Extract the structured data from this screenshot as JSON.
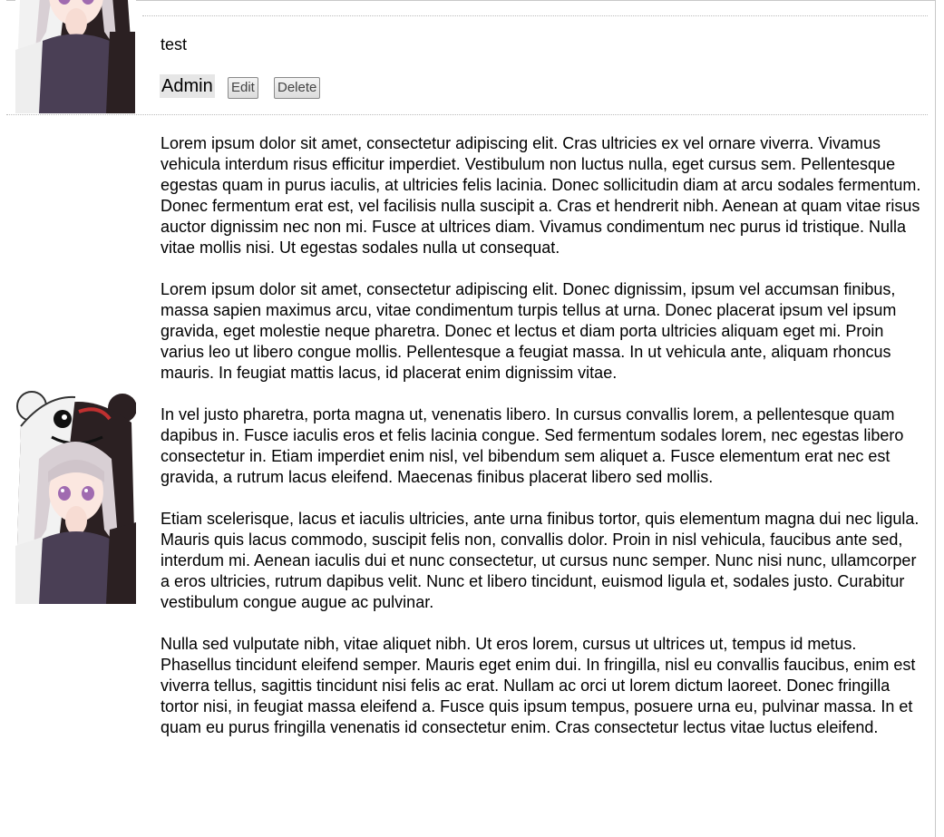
{
  "post": {
    "title": "test",
    "author": "Admin",
    "edit_label": "Edit",
    "delete_label": "Delete",
    "paragraphs": [
      "Lorem ipsum dolor sit amet, consectetur adipiscing elit. Cras ultricies ex vel ornare viverra. Vivamus vehicula interdum risus efficitur imperdiet. Vestibulum non luctus nulla, eget cursus sem. Pellentesque egestas quam in purus iaculis, at ultricies felis lacinia. Donec sollicitudin diam at arcu sodales fermentum. Donec fermentum erat est, vel facilisis nulla suscipit a. Cras et hendrerit nibh. Aenean at quam vitae risus auctor dignissim nec non mi. Fusce at ultrices diam. Vivamus condimentum nec purus id tristique. Nulla vitae mollis nisi. Ut egestas sodales nulla ut consequat.",
      "Lorem ipsum dolor sit amet, consectetur adipiscing elit. Donec dignissim, ipsum vel accumsan finibus, massa sapien maximus arcu, vitae condimentum turpis tellus at urna. Donec placerat ipsum vel ipsum gravida, eget molestie neque pharetra. Donec et lectus et diam porta ultricies aliquam eget mi. Proin varius leo ut libero congue mollis. Pellentesque a feugiat massa. In ut vehicula ante, aliquam rhoncus mauris. In feugiat mattis lacus, id placerat enim dignissim vitae.",
      "In vel justo pharetra, porta magna ut, venenatis libero. In cursus convallis lorem, a pellentesque quam dapibus in. Fusce iaculis eros et felis lacinia congue. Sed fermentum sodales lorem, nec egestas libero consectetur in. Etiam imperdiet enim nisl, vel bibendum sem aliquet a. Fusce elementum erat nec est gravida, a rutrum lacus eleifend. Maecenas finibus placerat libero sed mollis.",
      "Etiam scelerisque, lacus et iaculis ultricies, ante urna finibus tortor, quis elementum magna dui nec ligula. Mauris quis lacus commodo, suscipit felis non, convallis dolor. Proin in nisl vehicula, faucibus ante sed, interdum mi. Aenean iaculis dui et nunc consectetur, ut cursus nunc semper. Nunc nisi nunc, ullamcorper a eros ultricies, rutrum dapibus velit. Nunc et libero tincidunt, euismod ligula et, sodales justo. Curabitur vestibulum congue augue ac pulvinar.",
      "Nulla sed vulputate nibh, vitae aliquet nibh. Ut eros lorem, cursus ut ultrices ut, tempus id metus. Phasellus tincidunt eleifend semper. Mauris eget enim dui. In fringilla, nisl eu convallis faucibus, enim est viverra tellus, sagittis tincidunt nisi felis ac erat. Nullam ac orci ut lorem dictum laoreet. Donec fringilla tortor nisi, in feugiat massa eleifend a. Fusce quis ipsum tempus, posuere urna eu, pulvinar massa. In et quam eu purus fringilla venenatis id consectetur enim. Cras consectetur lectus vitae luctus eleifend."
    ]
  },
  "icons": {
    "avatar": "anime-girl-bear-hood-avatar"
  },
  "colors": {
    "badge_bg": "#e6e6e6",
    "divider": "#bbbbbb",
    "button_border": "#8a8a8a"
  }
}
